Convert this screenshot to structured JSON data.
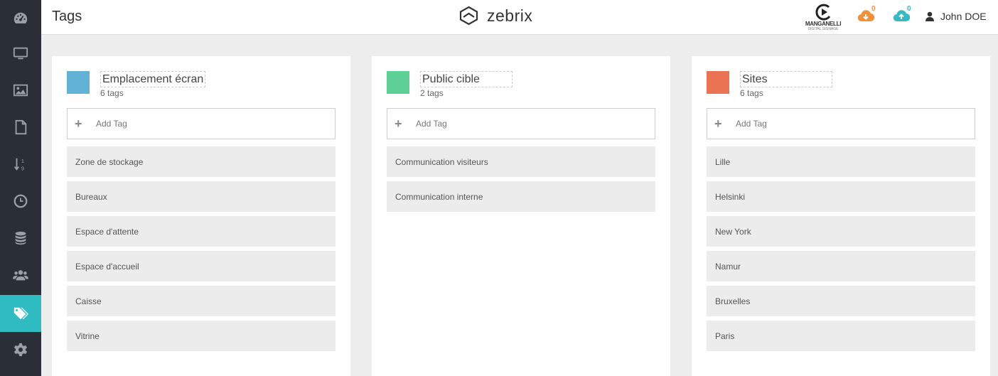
{
  "header": {
    "title": "Tags",
    "brand": "zebrix",
    "partner": {
      "name": "MANGANELLI",
      "subtitle": "DIGITAL SIGNAGE"
    },
    "download_count": "0",
    "upload_count": "0",
    "user_name": "John DOE"
  },
  "sidebar": {
    "items": [
      {
        "icon": "dashboard-icon"
      },
      {
        "icon": "monitor-icon"
      },
      {
        "icon": "image-icon"
      },
      {
        "icon": "file-icon"
      },
      {
        "icon": "sort-numeric-icon"
      },
      {
        "icon": "clock-icon"
      },
      {
        "icon": "database-icon"
      },
      {
        "icon": "users-icon"
      },
      {
        "icon": "tags-icon",
        "active": true
      },
      {
        "icon": "gear-icon"
      }
    ]
  },
  "groups": [
    {
      "name": "Emplacement écran",
      "count_label": "6 tags",
      "color": "#62b2d6",
      "add_label": "Add Tag",
      "tags": [
        "Zone de stockage",
        "Bureaux",
        "Espace d'attente",
        "Espace d'accueil",
        "Caisse",
        "Vitrine"
      ]
    },
    {
      "name": "Public cible",
      "count_label": "2 tags",
      "color": "#5dcf97",
      "add_label": "Add Tag",
      "tags": [
        "Communication visiteurs",
        "Communication interne"
      ]
    },
    {
      "name": "Sites",
      "count_label": "6 tags",
      "color": "#ea7354",
      "add_label": "Add Tag",
      "tags": [
        "Lille",
        "Helsinki",
        "New York",
        "Namur",
        "Bruxelles",
        "Paris"
      ]
    }
  ],
  "colors": {
    "sidebar_bg": "#2a2f37",
    "accent": "#2ebbc2",
    "download": "#f0913a",
    "upload": "#36b9c0"
  }
}
